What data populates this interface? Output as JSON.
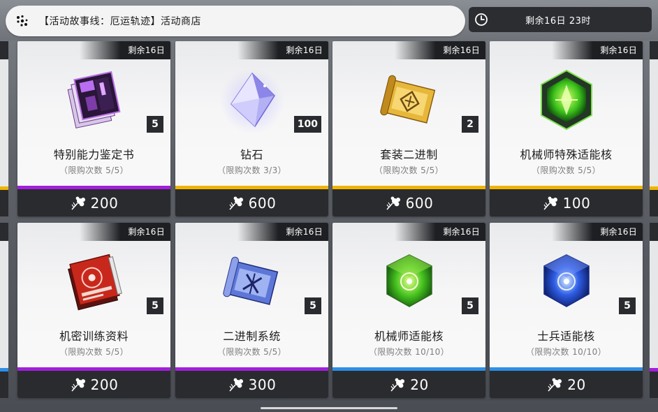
{
  "header": {
    "title": "【活动故事线：厄运轨迹】活动商店",
    "timer": "剩余16日 23时"
  },
  "colors": {
    "purple": "#a21fdc",
    "yellow": "#f0b400",
    "blue": "#2d8fe6"
  },
  "shop": {
    "items": [
      {
        "remain": "剩余16日",
        "name": "特别能力鉴定书",
        "limit": "（限购次数 5/5）",
        "qty": "5",
        "price": "200",
        "rarity": "purple",
        "icon": "ability-book-icon"
      },
      {
        "remain": "剩余16日",
        "name": "钻石",
        "limit": "（限购次数 3/3）",
        "qty": "100",
        "price": "600",
        "rarity": "yellow",
        "icon": "diamond-icon"
      },
      {
        "remain": "剩余16日",
        "name": "套装二进制",
        "limit": "（限购次数 5/5）",
        "qty": "2",
        "price": "600",
        "rarity": "yellow",
        "icon": "gold-scroll-icon"
      },
      {
        "remain": "剩余16日",
        "name": "机械师特殊适能核",
        "limit": "（限购次数 5/5）",
        "qty": "",
        "price": "100",
        "rarity": "yellow",
        "icon": "green-core-icon"
      },
      {
        "remain": "剩余16日",
        "name": "机密训练资料",
        "limit": "（限购次数 5/5）",
        "qty": "5",
        "price": "200",
        "rarity": "purple",
        "icon": "red-file-icon"
      },
      {
        "remain": "剩余16日",
        "name": "二进制系统",
        "limit": "（限购次数 5/5）",
        "qty": "5",
        "price": "300",
        "rarity": "purple",
        "icon": "blue-scroll-icon"
      },
      {
        "remain": "剩余16日",
        "name": "机械师适能核",
        "limit": "（限购次数 10/10）",
        "qty": "5",
        "price": "20",
        "rarity": "blue",
        "icon": "green-cube-icon"
      },
      {
        "remain": "剩余16日",
        "name": "士兵适能核",
        "limit": "（限购次数 10/10）",
        "qty": "5",
        "price": "20",
        "rarity": "blue",
        "icon": "blue-cube-icon"
      }
    ]
  }
}
